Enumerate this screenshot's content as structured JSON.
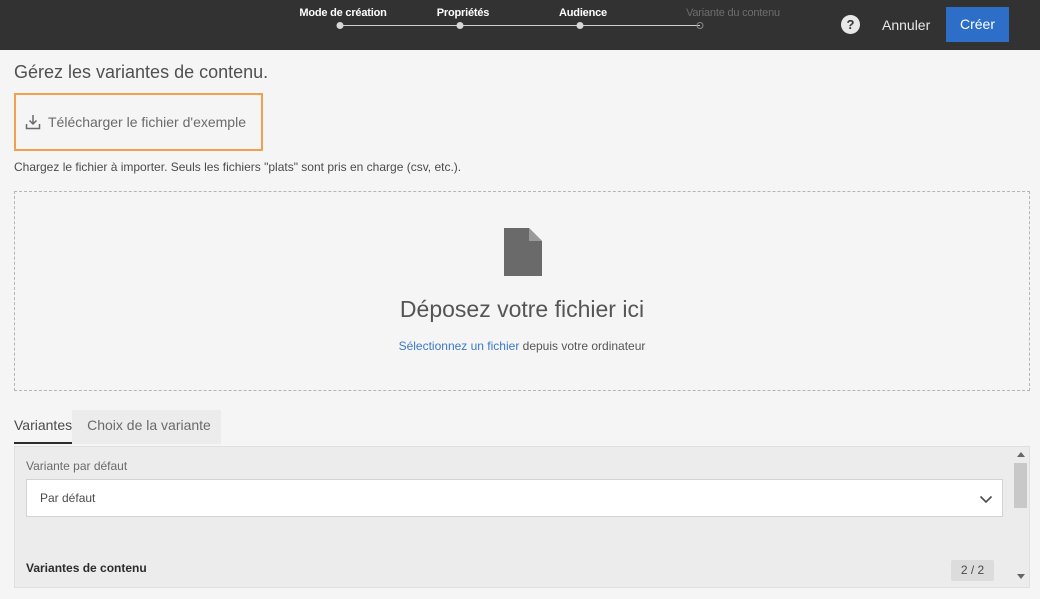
{
  "wizard": {
    "steps": [
      {
        "label": "Mode de création",
        "state": "done"
      },
      {
        "label": "Propriétés",
        "state": "done"
      },
      {
        "label": "Audience",
        "state": "current"
      },
      {
        "label": "Variante du contenu",
        "state": "todo"
      }
    ],
    "help_icon": "question-mark-icon",
    "cancel_label": "Annuler",
    "create_label": "Créer"
  },
  "page": {
    "heading": "Gérez les variantes de contenu.",
    "download_label": "Télécharger le fichier d'exemple",
    "download_icon": "download-icon",
    "import_hint": "Chargez le fichier à importer. Seuls les fichiers \"plats\" sont pris en charge (csv, etc.)."
  },
  "dropzone": {
    "icon": "file-icon",
    "title": "Déposez votre fichier ici",
    "link_text": "Sélectionnez un fichier",
    "sub_text": " depuis votre ordinateur"
  },
  "tabs": [
    {
      "label": "Variantes",
      "active": true
    },
    {
      "label": "Choix de la variante",
      "active": false
    }
  ],
  "panel": {
    "default_variant_label": "Variante par défaut",
    "default_variant_value": "Par défaut",
    "content_variants_title": "Variantes de contenu",
    "counter": "2 / 2"
  },
  "colors": {
    "topbar": "#323232",
    "primary": "#2d6ec9",
    "highlight": "#f0a04e",
    "link": "#3b78c8"
  }
}
